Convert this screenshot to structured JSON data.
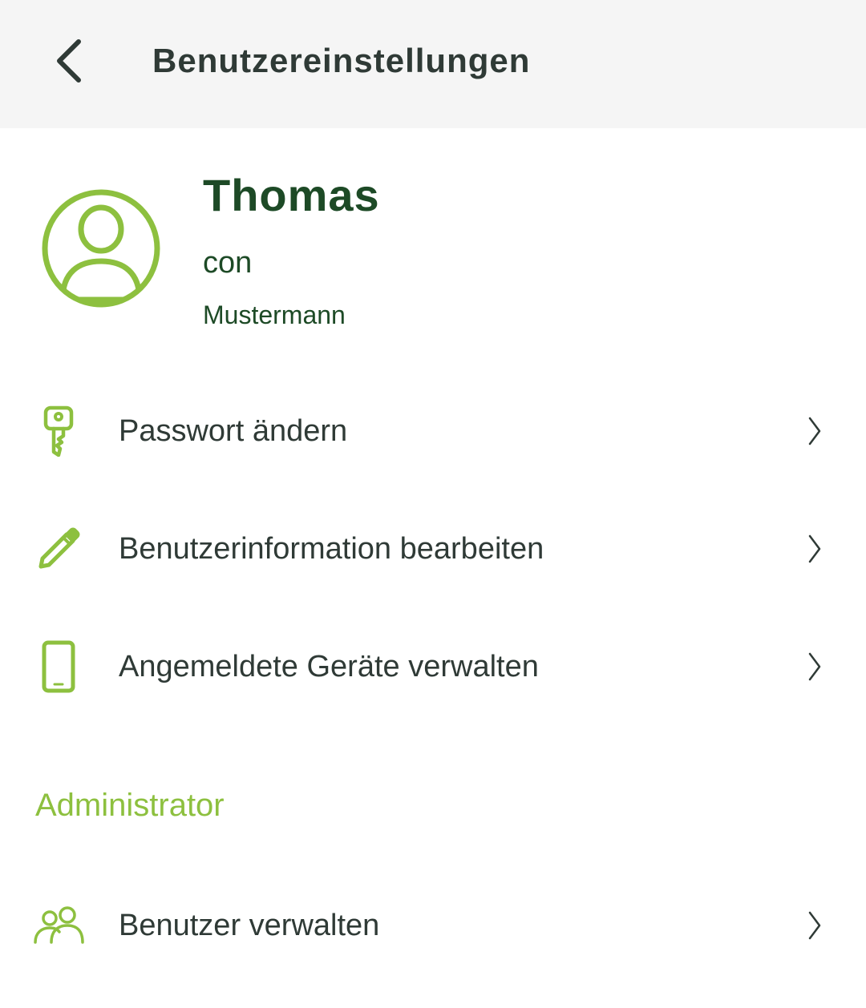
{
  "header": {
    "title": "Benutzereinstellungen",
    "back_icon": "chevron-left-icon"
  },
  "profile": {
    "first_name": "Thomas",
    "middle": "con",
    "last_name": "Mustermann",
    "avatar_icon": "user-circle-icon"
  },
  "menu": {
    "items": [
      {
        "label": "Passwort ändern",
        "icon": "key-icon"
      },
      {
        "label": "Benutzerinformation bearbeiten",
        "icon": "pencil-icon"
      },
      {
        "label": "Angemeldete Geräte verwalten",
        "icon": "smartphone-icon"
      }
    ]
  },
  "admin": {
    "section_title": "Administrator",
    "items": [
      {
        "label": "Benutzer verwalten",
        "icon": "users-icon"
      }
    ]
  },
  "colors": {
    "accent": "#8dc03f",
    "dark_green": "#1d4a26",
    "text": "#2f3a36",
    "header_bg": "#f5f5f5"
  }
}
